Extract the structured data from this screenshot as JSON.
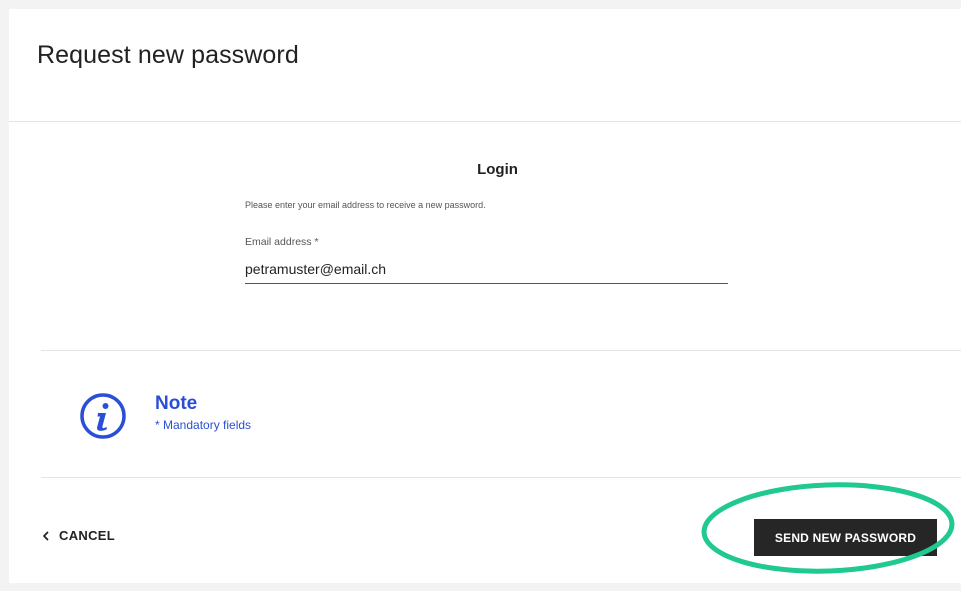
{
  "page": {
    "title": "Request new password"
  },
  "form": {
    "heading": "Login",
    "instruction": "Please enter your email address to receive a new password.",
    "email_label": "Email address *",
    "email_value": "petramuster@email.ch"
  },
  "note": {
    "icon": "info-icon",
    "title": "Note",
    "text": "* Mandatory fields"
  },
  "actions": {
    "cancel_label": "CANCEL",
    "send_label": "SEND NEW PASSWORD"
  },
  "colors": {
    "accent_blue": "#2a4fd6",
    "button_dark": "#262626",
    "highlight_green": "#1fc98f"
  }
}
